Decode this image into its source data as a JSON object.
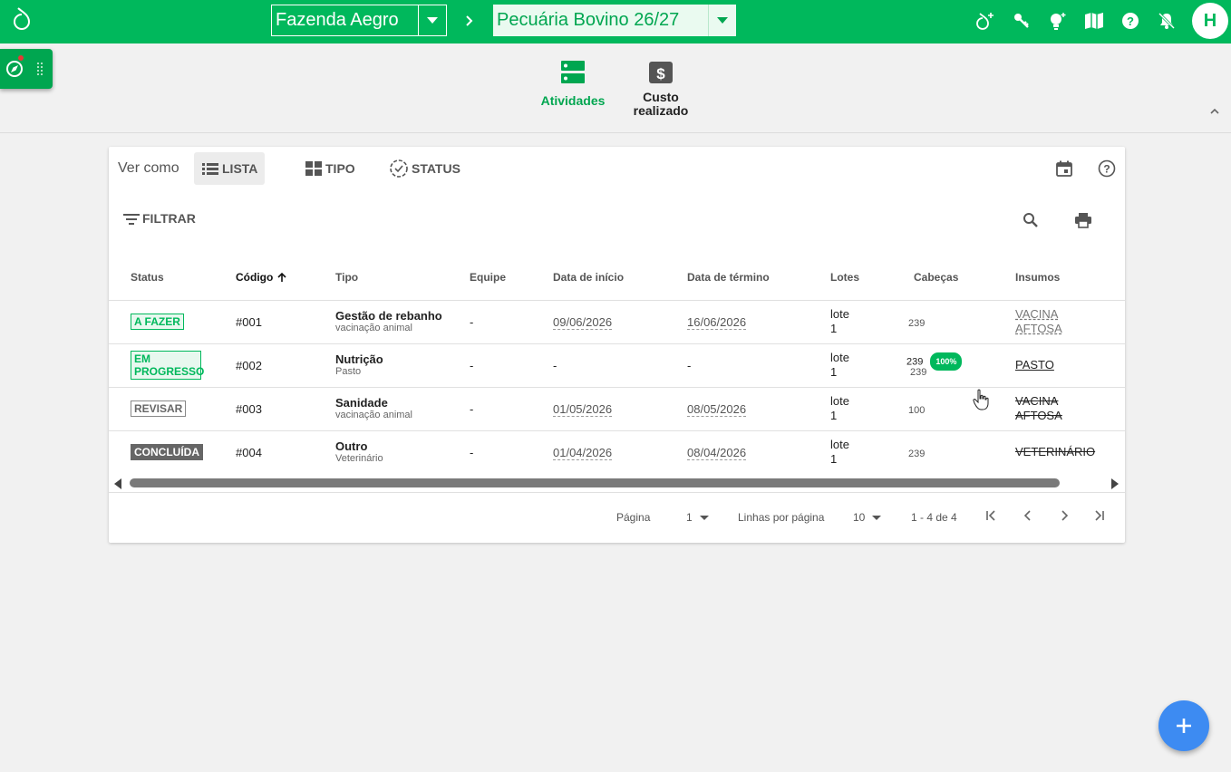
{
  "header": {
    "farm": "Fazenda Aegro",
    "season": "Pecuária Bovino 26/27",
    "avatar": "H",
    "icons": [
      "logo-icon",
      "add-user-icon",
      "key-icon",
      "lightbulb-icon",
      "map-book-icon",
      "help-icon",
      "notifications-off-icon"
    ],
    "colors": {
      "brand": "#00b85c",
      "fab": "#3d8bf2"
    }
  },
  "modules": [
    {
      "label": "Atividades",
      "active": true
    },
    {
      "label": "Custo realizado",
      "active": false
    }
  ],
  "view": {
    "label": "Ver como",
    "options": [
      "LISTA",
      "TIPO",
      "STATUS"
    ],
    "selected": "LISTA",
    "filter_label": "FILTRAR"
  },
  "table": {
    "columns": [
      "Status",
      "Código",
      "Tipo",
      "Equipe",
      "Data de início",
      "Data de término",
      "Lotes",
      "Cabeças",
      "Insumos"
    ],
    "sorted_column": "Código",
    "rows": [
      {
        "status": "A FAZER",
        "code": "#001",
        "type": "Gestão de rebanho",
        "subtype": "vacinação animal",
        "team": "-",
        "start": "09/06/2026",
        "end": "16/06/2026",
        "lots_1": "lote",
        "lots_2": "1",
        "heads": "239",
        "input_1": "VACINA",
        "input_2": "AFTOSA"
      },
      {
        "status": "EM PROGRESSO",
        "code": "#002",
        "type": "Nutrição",
        "subtype": "Pasto",
        "team": "-",
        "start": "-",
        "end": "-",
        "lots_1": "lote",
        "lots_2": "1",
        "heads": "239",
        "heads_2": "239",
        "progress": "100%",
        "input_1": "PASTO"
      },
      {
        "status": "REVISAR",
        "code": "#003",
        "type": "Sanidade",
        "subtype": "vacinação animal",
        "team": "-",
        "start": "01/05/2026",
        "end": "08/05/2026",
        "lots_1": "lote",
        "lots_2": "1",
        "heads": "100",
        "input_1": "VACINA",
        "input_2": "AFTOSA"
      },
      {
        "status": "CONCLUÍDA",
        "code": "#004",
        "type": "Outro",
        "subtype": "Veterinário",
        "team": "-",
        "start": "01/04/2026",
        "end": "08/04/2026",
        "lots_1": "lote",
        "lots_2": "1",
        "heads": "239",
        "input_1": "VETERINÁRIO"
      }
    ]
  },
  "pagination": {
    "page_label": "Página",
    "page": "1",
    "rows_label": "Linhas por página",
    "rows": "10",
    "range": "1 - 4 de 4"
  }
}
